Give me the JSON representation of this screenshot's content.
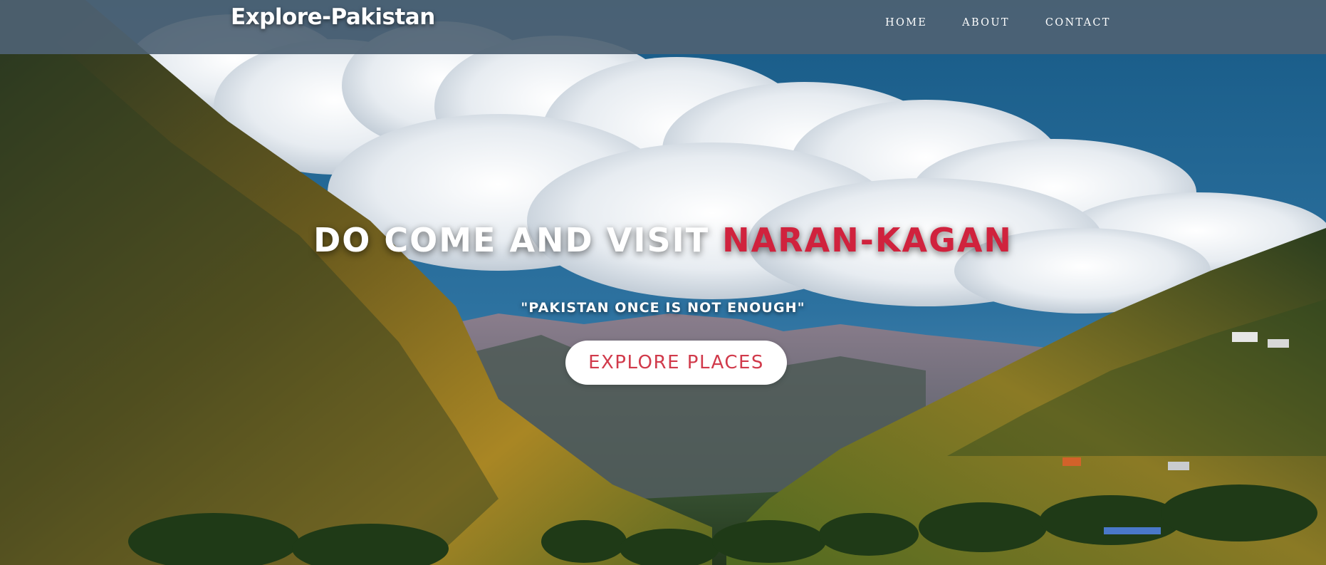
{
  "navbar": {
    "brand": "Explore-Pakistan",
    "links": [
      {
        "label": "HOME"
      },
      {
        "label": "ABOUT"
      },
      {
        "label": "CONTACT"
      }
    ],
    "background_color": "#4e6273"
  },
  "hero": {
    "headline_prefix": "DO COME AND VISIT",
    "headline_accent": "NARAN-KAGAN",
    "tagline": "\"PAKISTAN ONCE IS NOT ENOUGH\"",
    "cta_label": "EXPLORE PLACES",
    "accent_color": "#d0223d",
    "background_image": "mountain-valley-photo"
  }
}
